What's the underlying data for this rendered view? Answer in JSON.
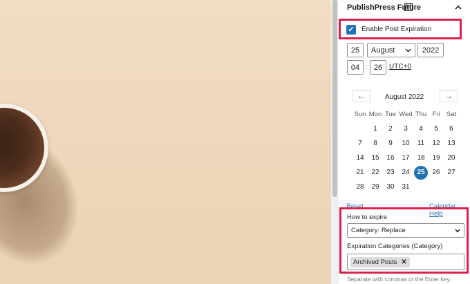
{
  "panel": {
    "title": "PublishPress Future"
  },
  "expiration": {
    "enable_label": "Enable Post Expiration",
    "checked": true
  },
  "date": {
    "day": "25",
    "month": "August",
    "year": "2022",
    "hour": "04",
    "minute": "26",
    "timezone": "UTC+0"
  },
  "calendar": {
    "title": "August 2022",
    "prev_arrow": "←",
    "next_arrow": "→",
    "weekdays": [
      "Sun",
      "Mon",
      "Tue",
      "Wed",
      "Thu",
      "Fri",
      "Sat"
    ],
    "weeks": [
      [
        "",
        "1",
        "2",
        "3",
        "4",
        "5",
        "6"
      ],
      [
        "7",
        "8",
        "9",
        "10",
        "11",
        "12",
        "13"
      ],
      [
        "14",
        "15",
        "16",
        "17",
        "18",
        "19",
        "20"
      ],
      [
        "21",
        "22",
        "23",
        "24",
        "25",
        "26",
        "27"
      ],
      [
        "28",
        "29",
        "30",
        "31",
        "",
        "",
        ""
      ]
    ],
    "selected_day": "25",
    "reset_label": "Reset",
    "help_label": "Calendar Help"
  },
  "how_to_expire": {
    "label": "How to expire",
    "value": "Category: Replace"
  },
  "categories": {
    "label": "Expiration Categories (Category)",
    "tokens": [
      "Archived Posts"
    ],
    "remove_glyph": "✕",
    "hint": "Separate with commas or the Enter key."
  },
  "colors": {
    "accent": "#2271b1",
    "highlight": "#d9214e"
  }
}
